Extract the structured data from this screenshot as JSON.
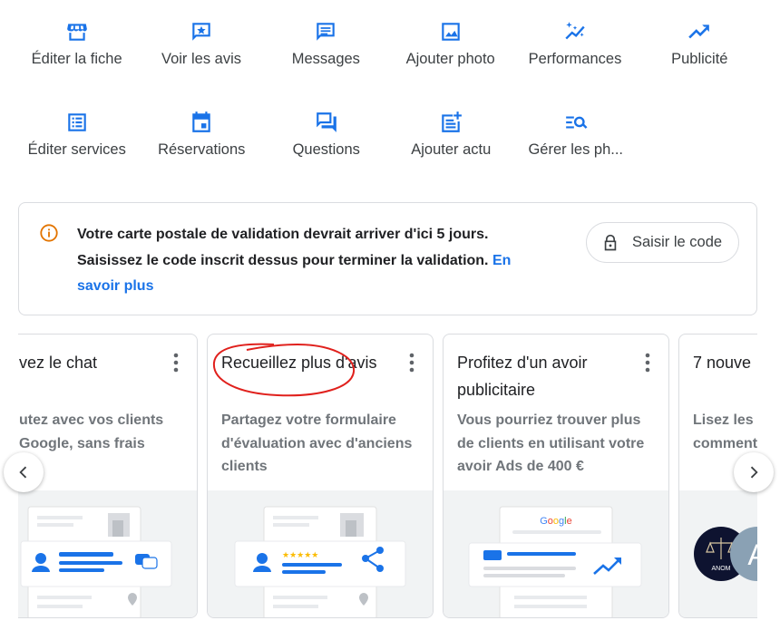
{
  "actions": [
    {
      "label": "Éditer la fiche",
      "icon": "storefront-icon"
    },
    {
      "label": "Voir les avis",
      "icon": "star-review-icon"
    },
    {
      "label": "Messages",
      "icon": "message-icon"
    },
    {
      "label": "Ajouter photo",
      "icon": "photo-icon"
    },
    {
      "label": "Performances",
      "icon": "sparkle-trend-icon"
    },
    {
      "label": "Publicité",
      "icon": "trending-up-icon"
    },
    {
      "label": "Éditer services",
      "icon": "list-icon"
    },
    {
      "label": "Réservations",
      "icon": "calendar-icon"
    },
    {
      "label": "Questions",
      "icon": "question-chat-icon"
    },
    {
      "label": "Ajouter actu",
      "icon": "post-add-icon"
    },
    {
      "label": "Gérer les ph...",
      "icon": "manage-search-icon"
    }
  ],
  "banner": {
    "line1": "Votre carte postale de validation devrait arriver d'ici 5 jours.",
    "line2": "Saisissez le code inscrit dessus pour terminer la validation.",
    "link": "En savoir plus",
    "button": "Saisir le code",
    "icon_color": "#e37400"
  },
  "cards": [
    {
      "title": "vez le chat",
      "desc": "utez avec vos clients Google, sans frais"
    },
    {
      "title": "Recueillez plus d'avis",
      "desc": "Partagez votre formulaire d'évaluation avec d'anciens clients"
    },
    {
      "title": "Profitez d'un avoir publicitaire",
      "desc": "Vous pourriez trouver plus de clients en utilisant votre avoir Ads de 400 €",
      "logo": "Google"
    },
    {
      "title": "7 nouve",
      "desc": "Lisez les comment",
      "avatar_text": "ANOM",
      "avatar_letter": "A"
    }
  ],
  "colors": {
    "accent": "#1a73e8",
    "annotation": "#e0201c"
  }
}
